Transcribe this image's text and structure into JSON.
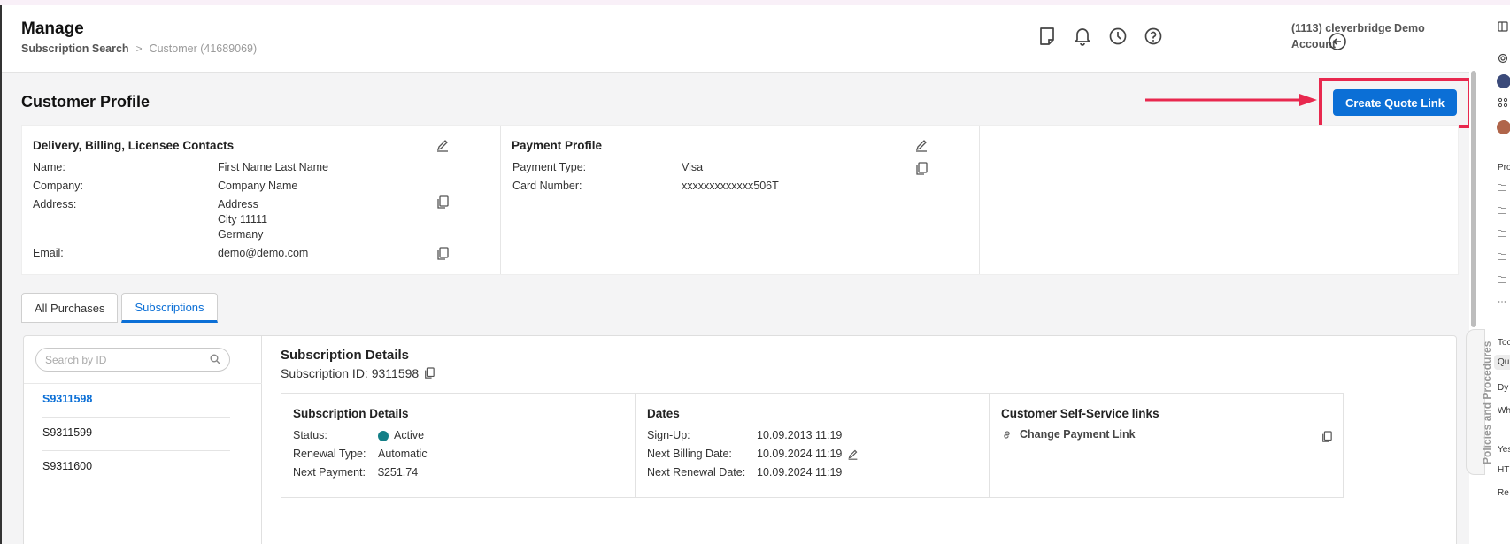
{
  "header": {
    "title": "Manage",
    "breadcrumb": [
      "Subscription Search",
      "Customer (41689069)"
    ],
    "account": "(1113) cleverbridge Demo Account"
  },
  "page": {
    "title": "Customer Profile",
    "create_quote_label": "Create Quote Link"
  },
  "contacts": {
    "title": "Delivery, Billing, Licensee Contacts",
    "name_label": "Name:",
    "name": "First Name Last Name",
    "company_label": "Company:",
    "company": "Company Name",
    "address_label": "Address:",
    "address": "Address\nCity 11111\nGermany",
    "email_label": "Email:",
    "email": "demo@demo.com"
  },
  "payment": {
    "title": "Payment Profile",
    "type_label": "Payment Type:",
    "type": "Visa",
    "card_label": "Card Number:",
    "card": "xxxxxxxxxxxxx506T"
  },
  "tabs": [
    "All Purchases",
    "Subscriptions"
  ],
  "active_tab": "Subscriptions",
  "search": {
    "placeholder": "Search by ID"
  },
  "subscriptions": [
    "S9311598",
    "S9311599",
    "S9311600"
  ],
  "selected_subscription": "S9311598",
  "details": {
    "title": "Subscription Details",
    "id_text": "Subscription ID: 9311598",
    "card_title": "Subscription Details",
    "status_label": "Status:",
    "status": "Active",
    "status_color": "#147f87",
    "renewal_label": "Renewal Type:",
    "renewal": "Automatic",
    "next_payment_label": "Next Payment:",
    "next_payment": "$251.74"
  },
  "dates": {
    "title": "Dates",
    "signup_label": "Sign-Up:",
    "signup": "10.09.2013 11:19",
    "billing_label": "Next Billing Date:",
    "billing": "10.09.2024 11:19",
    "renewal_label": "Next Renewal Date:",
    "renewal": "10.09.2024 11:19"
  },
  "self_service": {
    "title": "Customer Self-Service links",
    "link": "Change Payment Link"
  },
  "policies_tab": "Policies and Procedures",
  "right_panel": [
    "Pro",
    "Too",
    "Qu",
    "Dy",
    "Wh",
    "Yes",
    "HT",
    "Re"
  ],
  "colors": {
    "accent": "#0b6fd6",
    "highlight": "#e8284e"
  }
}
